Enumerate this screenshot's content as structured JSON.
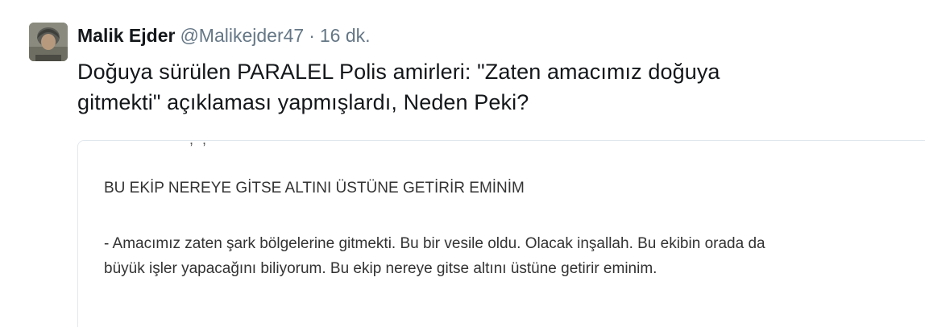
{
  "tweet": {
    "author_name": "Malik Ejder",
    "author_handle": "@Malikejder47",
    "separator": "·",
    "timestamp": "16 dk.",
    "avatar_icon": "user-avatar",
    "text_line1": "Doğuya sürülen PARALEL Polis amirleri: \"Zaten amacımız doğuya",
    "text_line2": "gitmekti\" açıklaması yapmışlardı, Neden Peki?"
  },
  "card": {
    "cut_text": "- - , ,",
    "title": "BU EKİP NEREYE GİTSE ALTINI ÜSTÜNE GETİRİR EMİNİM",
    "body_line1": "- Amacımız zaten şark bölgelerine gitmekti. Bu bir vesile oldu. Olacak inşallah. Bu ekibin orada da",
    "body_line2": "büyük işler yapacağını biliyorum. Bu ekip nereye gitse altını üstüne getirir eminim."
  },
  "colors": {
    "text": "#14171a",
    "secondary": "#657786",
    "card_border": "#e1e8ed",
    "card_text": "#333333"
  }
}
